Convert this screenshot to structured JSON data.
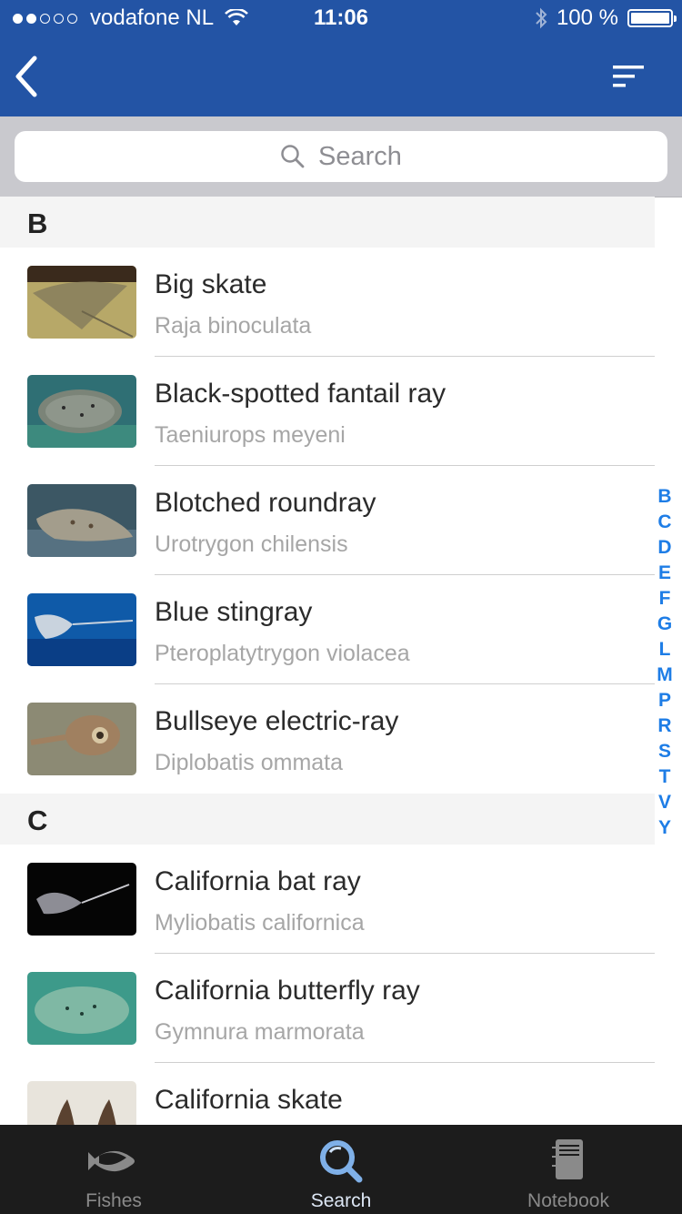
{
  "status_bar": {
    "carrier": "vodafone NL",
    "time": "11:06",
    "battery": "100 %",
    "battery_level": 1.0
  },
  "icons": {
    "back": "chevron-left-icon",
    "filter": "filter-lines-icon",
    "search": "search-icon",
    "wifi": "wifi-icon",
    "bluetooth": "bluetooth-icon",
    "battery": "battery-icon"
  },
  "search": {
    "placeholder": "Search"
  },
  "sections": [
    {
      "letter": "B",
      "items": [
        {
          "name": "Big skate",
          "scientific": "Raja binoculata"
        },
        {
          "name": "Black-spotted fantail ray",
          "scientific": "Taeniurops meyeni"
        },
        {
          "name": "Blotched roundray",
          "scientific": "Urotrygon chilensis"
        },
        {
          "name": "Blue stingray",
          "scientific": "Pteroplatytrygon violacea"
        },
        {
          "name": "Bullseye electric-ray",
          "scientific": "Diplobatis ommata"
        }
      ]
    },
    {
      "letter": "C",
      "items": [
        {
          "name": "California bat ray",
          "scientific": "Myliobatis californica"
        },
        {
          "name": "California butterfly ray",
          "scientific": "Gymnura marmorata"
        },
        {
          "name": "California skate",
          "scientific": ""
        }
      ]
    }
  ],
  "index_letters": [
    "B",
    "C",
    "D",
    "E",
    "F",
    "G",
    "L",
    "M",
    "P",
    "R",
    "S",
    "T",
    "V",
    "Y"
  ],
  "tabs": [
    {
      "label": "Fishes",
      "icon": "fish-icon",
      "active": false
    },
    {
      "label": "Search",
      "icon": "search-icon",
      "active": true
    },
    {
      "label": "Notebook",
      "icon": "notebook-icon",
      "active": false
    }
  ],
  "colors": {
    "header": "#2354a5",
    "index": "#1e7de6",
    "tabbar": "#1c1c1c"
  }
}
